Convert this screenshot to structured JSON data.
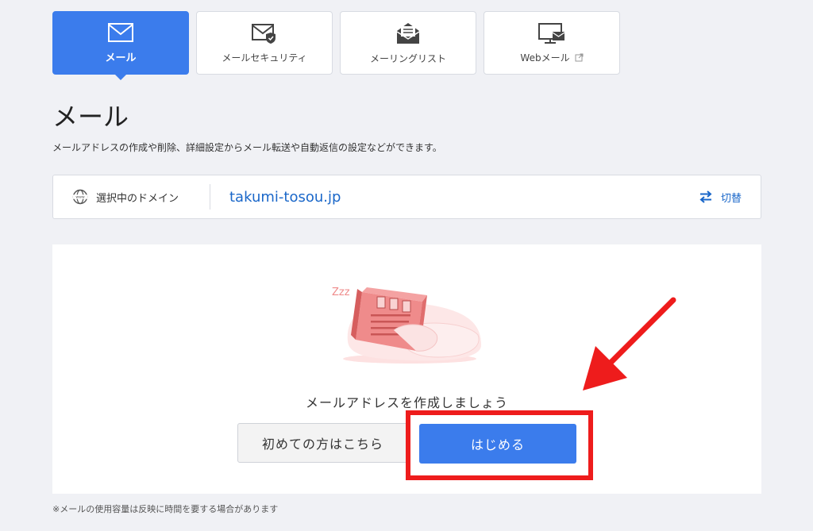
{
  "tabs": [
    {
      "label": "メール",
      "icon": "mail-icon",
      "active": true
    },
    {
      "label": "メールセキュリティ",
      "icon": "mail-security-icon",
      "active": false
    },
    {
      "label": "メーリングリスト",
      "icon": "mailing-list-icon",
      "active": false
    },
    {
      "label": "Webメール",
      "icon": "webmail-icon",
      "active": false,
      "external": true
    }
  ],
  "page": {
    "title": "メール",
    "description": "メールアドレスの作成や削除、詳細設定からメール転送や自動返信の設定などができます。"
  },
  "domain": {
    "label": "選択中のドメイン",
    "value": "takumi-tosou.jp",
    "switch_label": "切替",
    "globe_text": "www"
  },
  "empty_state": {
    "illustration_text": "Zzz",
    "message": "メールアドレスを作成しましょう",
    "guide_button": "初めての方はこちら",
    "start_button": "はじめる"
  },
  "footnote": "※メールの使用容量は反映に時間を要する場合があります",
  "colors": {
    "accent": "#3b7cec",
    "link": "#1a67c9",
    "annotation_red": "#ee1c1c",
    "background": "#f0f1f5"
  }
}
